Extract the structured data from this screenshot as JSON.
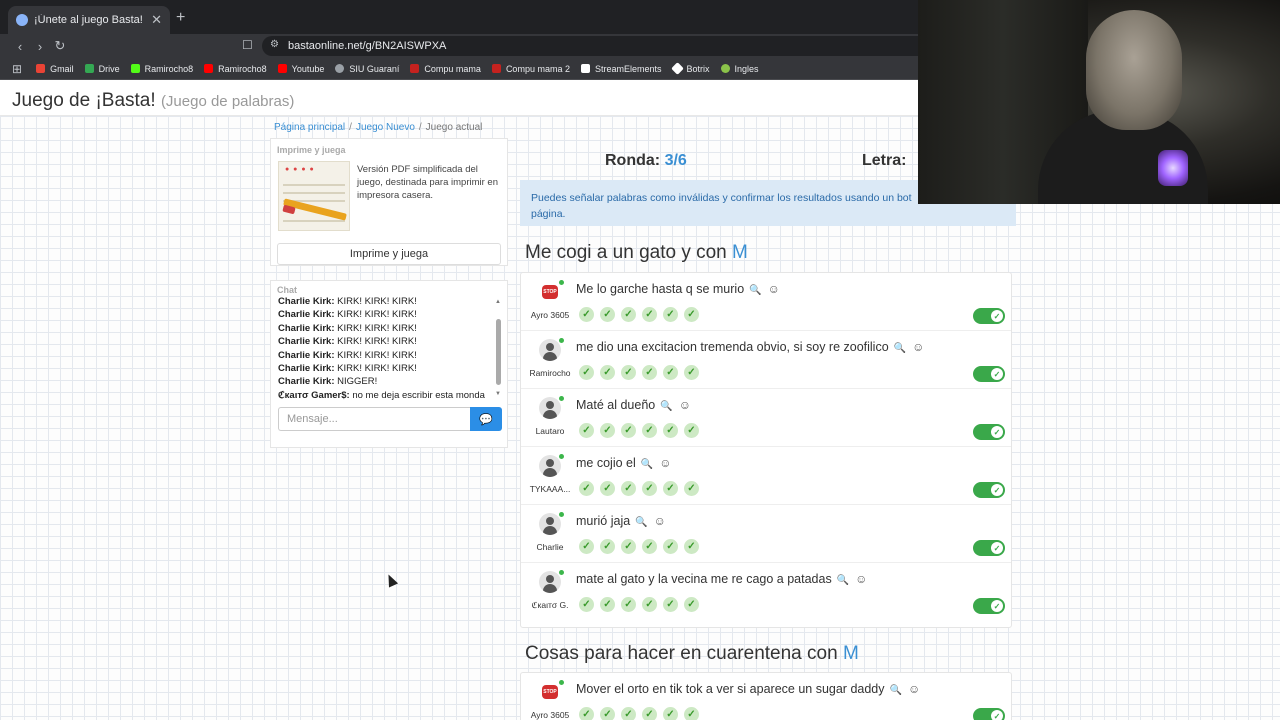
{
  "browser": {
    "tab_title": "¡Únete al juego Basta!",
    "tab_close": "✕",
    "new_tab": "+",
    "url": "bastaonline.net/g/BN2AISWPXA",
    "bookmarks": [
      {
        "label": "Gmail",
        "color": "#ea4335"
      },
      {
        "label": "Drive",
        "color": "#34a853"
      },
      {
        "label": "Ramirocho8",
        "color": "#53fc18"
      },
      {
        "label": "Ramirocho8",
        "color": "#ff0000"
      },
      {
        "label": "Youtube",
        "color": "#ff0000"
      },
      {
        "label": "SIU Guaraní",
        "color": "#9aa0a6"
      },
      {
        "label": "Compu mama",
        "color": "#c5221f"
      },
      {
        "label": "Compu mama 2",
        "color": "#c5221f"
      },
      {
        "label": "StreamElements",
        "color": "#ffffff"
      },
      {
        "label": "Botrix",
        "color": "#ffffff"
      },
      {
        "label": "Ingles",
        "color": "#8bc34a"
      }
    ]
  },
  "header": {
    "title": "Juego de ¡Basta!",
    "subtitle": "(Juego de palabras)"
  },
  "breadcrumb": {
    "home": "Página principal",
    "new_game": "Juego Nuevo",
    "current": "Juego actual"
  },
  "print_panel": {
    "title": "Imprime y juega",
    "description": "Versión PDF simplificada del juego, destinada para imprimir en impresora casera.",
    "button": "Imprime y juega"
  },
  "chat": {
    "title": "Chat",
    "messages": [
      {
        "user": "Charlie Kirk:",
        "text": "KIRK! KIRK! KIRK!"
      },
      {
        "user": "Charlie Kirk:",
        "text": "KIRK! KIRK! KIRK!"
      },
      {
        "user": "Charlie Kirk:",
        "text": "KIRK! KIRK! KIRK!"
      },
      {
        "user": "Charlie Kirk:",
        "text": "KIRK! KIRK! KIRK!"
      },
      {
        "user": "Charlie Kirk:",
        "text": "KIRK! KIRK! KIRK!"
      },
      {
        "user": "Charlie Kirk:",
        "text": "KIRK! KIRK! KIRK!"
      },
      {
        "user": "Charlie Kirk:",
        "text": "NIGGER!"
      },
      {
        "user": "ℭкаιтσ Gamer$:",
        "text": "no me deja escribir esta monda"
      }
    ],
    "placeholder": "Mensaje...",
    "send_icon": "💬"
  },
  "game": {
    "round_label": "Ronda:",
    "round_value": "3/6",
    "letter_label": "Letra:",
    "notice": "Puedes señalar palabras como inválidas y confirmar los resultados usando un bot",
    "notice_line2": "página.",
    "categories": [
      {
        "title": "Me cogi a un gato y con",
        "letter": "M"
      },
      {
        "title": "Cosas para hacer en cuarentena con",
        "letter": "M"
      }
    ],
    "answers": [
      {
        "player": "Ayro 3605",
        "avatar": "stop",
        "text": "Me lo garche hasta q se murio"
      },
      {
        "player": "Ramirocho",
        "avatar": "user",
        "text": "me dio una excitacion tremenda obvio, si soy re zoofilico"
      },
      {
        "player": "Lautaro",
        "avatar": "user",
        "text": "Maté al dueño"
      },
      {
        "player": "TYKAAA...",
        "avatar": "user",
        "text": "me cojio el"
      },
      {
        "player": "Charlie",
        "avatar": "user",
        "text": "murió jaja"
      },
      {
        "player": "ℭкаιтσ G.",
        "avatar": "user",
        "text": "mate al gato y la vecina me re cago a patadas"
      }
    ],
    "answers_cat2": [
      {
        "player": "Ayro 3605",
        "avatar": "stop",
        "text": "Mover el orto en tik tok a ver si aparece un sugar daddy"
      }
    ],
    "stop_badge": "STOP",
    "check_glyph": "✓"
  }
}
